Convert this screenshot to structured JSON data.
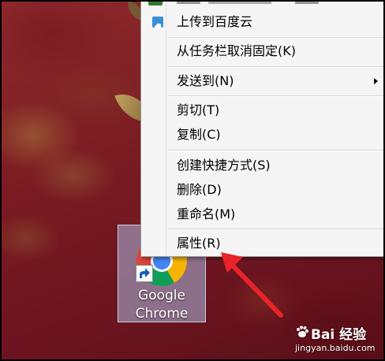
{
  "desktop_icon": {
    "label_line1": "Google",
    "label_line2": "Chrome",
    "icon": "chrome-icon"
  },
  "context_menu": {
    "items": [
      {
        "label": "上传到百度云",
        "icon": "baidu-cloud-icon"
      },
      {
        "label": "从任务栏取消固定(K)"
      },
      {
        "label": "发送到(N)",
        "submenu": true
      },
      {
        "label": "剪切(T)"
      },
      {
        "label": "复制(C)"
      },
      {
        "label": "创建快捷方式(S)"
      },
      {
        "label": "删除(D)"
      },
      {
        "label": "重命名(M)"
      },
      {
        "label": "属性(R)"
      }
    ]
  },
  "watermark": {
    "brand": "Bai 经验",
    "url": "jingyan.baidu.com"
  },
  "colors": {
    "desktop_background": "#7a1b22",
    "menu_background": "#f5f5f5",
    "annotation_arrow": "#e8232a"
  }
}
